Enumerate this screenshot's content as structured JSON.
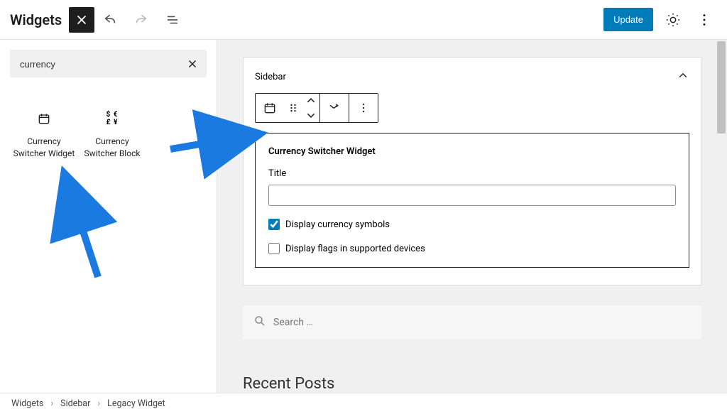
{
  "header": {
    "title": "Widgets",
    "update_label": "Update"
  },
  "search": {
    "value": "currency"
  },
  "blocks": [
    {
      "label": "Currency Switcher Widget"
    },
    {
      "label": "Currency Switcher Block"
    }
  ],
  "area": {
    "name": "Sidebar"
  },
  "widget": {
    "heading": "Currency Switcher Widget",
    "title_label": "Title",
    "title_value": "",
    "opt_symbols": "Display currency symbols",
    "opt_symbols_checked": true,
    "opt_flags": "Display flags in supported devices",
    "opt_flags_checked": false
  },
  "search_widget": {
    "placeholder": "Search …"
  },
  "recent_posts": {
    "heading": "Recent Posts"
  },
  "breadcrumb": {
    "root": "Widgets",
    "area": "Sidebar",
    "block": "Legacy Widget"
  }
}
